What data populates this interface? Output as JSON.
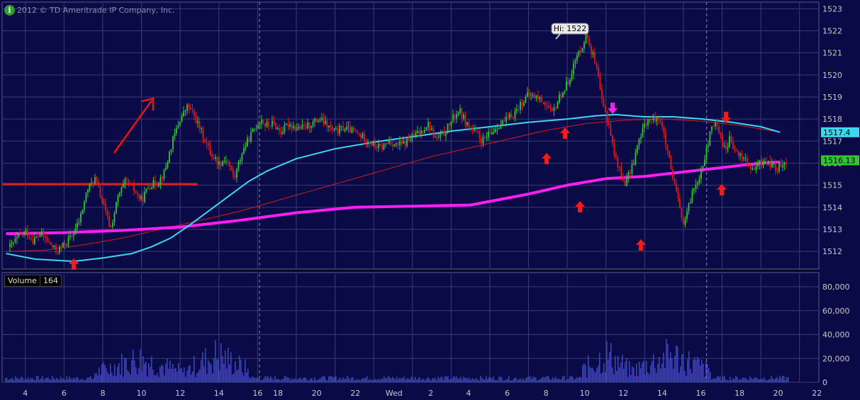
{
  "copyright": "2012 © TD Ameritrade IP Company, Inc.",
  "info_icon": "info-icon",
  "colors": {
    "background": "#0a0a46",
    "grid": "#3a3a7a",
    "up_candle": "#2ec82e",
    "down_candle": "#e01818",
    "ma_cyan": "#3fd6f0",
    "ma_magenta": "#ff1ef0",
    "ma_red": "#d01e1e",
    "volume_bar": "#3a44d8",
    "axis_text": "#c8c8c8"
  },
  "high_label": "Hi: 1522",
  "price_badges": {
    "cyan": "1517.4",
    "green": "1516.13"
  },
  "volume_panel": {
    "label": "Volume",
    "value": "164"
  },
  "chart_data": [
    {
      "type": "candlestick",
      "series": [
        {
          "name": "price",
          "x": [
            3.2,
            3.6,
            4.0,
            4.4,
            4.8,
            5.2,
            5.6,
            6.0,
            6.4,
            6.8,
            7.2,
            7.6,
            8.0,
            8.4,
            8.8,
            9.2,
            9.6,
            10.0,
            10.4,
            10.8,
            11.2,
            11.6,
            12.0,
            12.4,
            12.8,
            13.2,
            13.6,
            14.0,
            14.4,
            14.8,
            15.2,
            15.6,
            16.0,
            16.2,
            16.4,
            16.8,
            17.2,
            17.6,
            18.0,
            18.4,
            18.8,
            19.2,
            19.6,
            20.0,
            20.4,
            20.8,
            21.2,
            21.6,
            22.0,
            22.4,
            22.8,
            23.2,
            23.6,
            24.0,
            24.4,
            24.8,
            25.2,
            25.6,
            26.0,
            26.4,
            26.8,
            27.2,
            27.6,
            28.0,
            28.4,
            28.8,
            29.2,
            29.6,
            30.0,
            30.4,
            30.8,
            31.2,
            31.6,
            32.0,
            32.4,
            32.8,
            33.0,
            33.2,
            33.4,
            33.6,
            33.8,
            34.0,
            34.2,
            34.4,
            34.6,
            34.8,
            35.0,
            35.2,
            35.4,
            35.6,
            35.8,
            36.0,
            36.2,
            36.4,
            36.6,
            36.8,
            37.0,
            37.2,
            37.4,
            37.6,
            37.8,
            38.0,
            38.2,
            38.4,
            38.6,
            38.8,
            39.0,
            39.2,
            39.4,
            39.6,
            39.8,
            40.0,
            40.2,
            40.4,
            40.6,
            40.8,
            41.0,
            41.2,
            41.4,
            41.6,
            41.8,
            42.0,
            42.2,
            42.4,
            42.6,
            42.8,
            43.0,
            43.2,
            43.4
          ],
          "close": [
            1512.2,
            1512.6,
            1512.9,
            1512.5,
            1512.8,
            1512.4,
            1512.0,
            1512.3,
            1512.7,
            1513.4,
            1514.8,
            1515.3,
            1514.2,
            1513.0,
            1514.5,
            1515.2,
            1514.8,
            1514.3,
            1515.0,
            1515.1,
            1515.6,
            1517.0,
            1518.0,
            1518.6,
            1518.0,
            1517.2,
            1516.4,
            1516.0,
            1516.2,
            1515.3,
            1516.5,
            1517.2,
            1517.8,
            1518.0,
            1517.7,
            1517.8,
            1517.4,
            1517.8,
            1517.6,
            1517.6,
            1517.8,
            1518.0,
            1517.7,
            1517.4,
            1517.6,
            1517.5,
            1517.3,
            1517.1,
            1516.8,
            1516.7,
            1517.0,
            1516.8,
            1516.9,
            1517.2,
            1517.4,
            1517.8,
            1517.1,
            1517.3,
            1517.9,
            1518.4,
            1517.8,
            1517.4,
            1517.0,
            1517.3,
            1517.7,
            1517.9,
            1518.2,
            1518.7,
            1519.1,
            1519.0,
            1518.8,
            1518.2,
            1519.0,
            1519.6,
            1520.6,
            1521.4,
            1521.9,
            1521.2,
            1520.7,
            1519.8,
            1518.7,
            1518.2,
            1517.6,
            1516.5,
            1516.0,
            1515.4,
            1515.1,
            1515.5,
            1516.0,
            1516.7,
            1517.2,
            1517.8,
            1518.0,
            1517.9,
            1518.1,
            1518.0,
            1517.2,
            1516.4,
            1515.4,
            1514.8,
            1514.0,
            1513.2,
            1513.7,
            1514.5,
            1515.0,
            1515.4,
            1516.0,
            1516.6,
            1517.4,
            1517.8,
            1517.6,
            1516.9,
            1516.7,
            1517.1,
            1516.6,
            1516.4,
            1516.3,
            1516.2,
            1515.8,
            1515.6,
            1515.9,
            1516.0,
            1516.1,
            1516.0,
            1515.9,
            1515.7,
            1515.9,
            1516.1,
            1516.13
          ]
        },
        {
          "name": "ma_cyan",
          "x": [
            3.0,
            4.5,
            6.5,
            8.0,
            9.5,
            10.5,
            11.5,
            12.5,
            13.5,
            14.5,
            15.5,
            16.5,
            18.0,
            20.0,
            22.0,
            24.0,
            26.0,
            28.0,
            30.0,
            32.0,
            33.5,
            34.5,
            36.0,
            37.5,
            39.0,
            40.5,
            42.0,
            43.0
          ],
          "values": [
            1511.9,
            1511.65,
            1511.55,
            1511.7,
            1511.9,
            1512.2,
            1512.6,
            1513.2,
            1513.85,
            1514.5,
            1515.15,
            1515.65,
            1516.2,
            1516.65,
            1516.95,
            1517.2,
            1517.45,
            1517.65,
            1517.85,
            1518.0,
            1518.15,
            1518.2,
            1518.1,
            1518.1,
            1518.0,
            1517.85,
            1517.65,
            1517.4
          ]
        },
        {
          "name": "ma_magenta",
          "x": [
            3.0,
            6.0,
            9.0,
            12.0,
            15.0,
            18.0,
            21.0,
            24.0,
            27.0,
            30.0,
            32.0,
            34.0,
            36.0,
            38.0,
            40.0,
            42.0,
            43.0
          ],
          "values": [
            1512.8,
            1512.85,
            1512.95,
            1513.1,
            1513.4,
            1513.75,
            1514.0,
            1514.05,
            1514.1,
            1514.6,
            1515.0,
            1515.3,
            1515.4,
            1515.6,
            1515.8,
            1516.0,
            1516.05
          ]
        },
        {
          "name": "ma_red",
          "x": [
            3.0,
            5.0,
            7.0,
            9.0,
            11.0,
            13.0,
            15.0,
            17.0,
            19.0,
            21.0,
            23.0,
            25.0,
            27.0,
            29.0,
            31.0,
            33.0,
            35.0,
            37.0,
            39.0,
            41.0,
            43.0
          ],
          "values": [
            1512.0,
            1512.05,
            1512.3,
            1512.6,
            1513.0,
            1513.4,
            1513.8,
            1514.3,
            1514.8,
            1515.3,
            1515.8,
            1516.3,
            1516.7,
            1517.1,
            1517.5,
            1517.8,
            1517.95,
            1518.0,
            1517.9,
            1517.7,
            1517.4
          ]
        }
      ],
      "horizontal_line": 1515.05,
      "ylim": [
        1511.2,
        1523.3
      ],
      "yticks": [
        1512,
        1513,
        1514,
        1515,
        1516,
        1517,
        1518,
        1519,
        1520,
        1521,
        1522,
        1523
      ],
      "xlim": [
        2.8,
        45.0
      ],
      "xtick_positions": [
        4,
        6,
        8,
        10,
        12,
        14,
        16,
        16.9,
        18.9,
        20.9,
        22.9,
        24.9,
        26.9,
        28.9,
        30.9,
        32.9,
        34.9,
        36.9,
        38.9,
        40.9,
        42.9,
        44.9,
        46.9
      ],
      "grid": true,
      "dashed_separators": [
        16.1,
        39.2
      ],
      "annotations": [
        "Hi: 1522"
      ]
    },
    {
      "type": "bar",
      "name": "volume",
      "ylim": [
        0,
        80000
      ],
      "yticks": [
        0,
        20000,
        40000,
        60000,
        80000
      ],
      "ytick_labels": [
        "0",
        "20,000",
        "40,000",
        "60,000",
        "80,000"
      ],
      "xtick_labels": [
        "4",
        "6",
        "8",
        "10",
        "12",
        "14",
        "16",
        "18",
        "20",
        "22",
        "Wed",
        "2",
        "4",
        "6",
        "8",
        "10",
        "12",
        "14",
        "16",
        "18",
        "20",
        "22"
      ],
      "clusters": [
        {
          "x_start": 7.5,
          "x_end": 12.2,
          "peak": 34000
        },
        {
          "x_start": 12.2,
          "x_end": 15.6,
          "peak": 40000
        },
        {
          "x_start": 32.7,
          "x_end": 35.3,
          "peak": 40000
        },
        {
          "x_start": 35.3,
          "x_end": 39.4,
          "peak": 40000
        }
      ]
    }
  ]
}
